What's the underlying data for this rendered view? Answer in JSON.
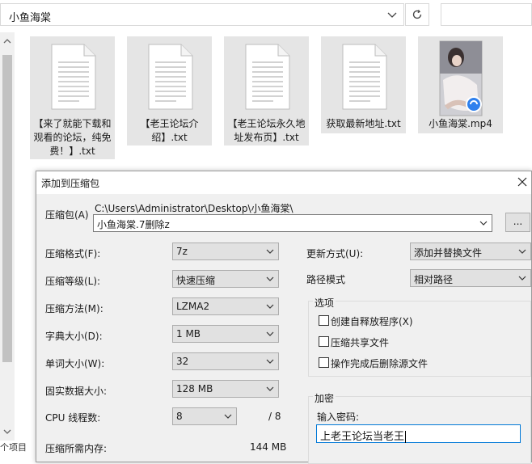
{
  "explorer": {
    "address": "小鱼海棠",
    "status_partial": "个项目",
    "files": [
      {
        "label": "【来了就能下载和观看的论坛，纯免费！】.txt",
        "kind": "txt"
      },
      {
        "label": "【老王论坛介绍】.txt",
        "kind": "txt"
      },
      {
        "label": "【老王论坛永久地址发布页】.txt",
        "kind": "txt"
      },
      {
        "label": "获取最新地址.txt",
        "kind": "txt"
      },
      {
        "label": "小鱼海棠.mp4",
        "kind": "mp4"
      }
    ]
  },
  "dialog": {
    "title": "添加到压缩包",
    "archive_label": "压缩包(A)",
    "archive_path": "C:\\Users\\Administrator\\Desktop\\小鱼海棠\\",
    "archive_name": "小鱼海棠.7删除z",
    "browse_label": "...",
    "format_label": "压缩格式(F):",
    "format_value": "7z",
    "level_label": "压缩等级(L):",
    "level_value": "快速压缩",
    "method_label": "压缩方法(M):",
    "method_value": "LZMA2",
    "dict_label": "字典大小(D):",
    "dict_value": "1 MB",
    "word_label": "单词大小(W):",
    "word_value": "32",
    "solid_label": "固实数据大小:",
    "solid_value": "128 MB",
    "cpu_label": "CPU 线程数:",
    "cpu_value": "8",
    "cpu_total": "/ 8",
    "memory_label": "压缩所需内存:",
    "memory_value": "144 MB",
    "update_label": "更新方式(U):",
    "update_value": "添加并替换文件",
    "path_mode_label": "路径模式",
    "path_mode_value": "相对路径",
    "options_title": "选项",
    "opt_sfx": "创建自释放程序(X)",
    "opt_shared": "压缩共享文件",
    "opt_delete": "操作完成后删除源文件",
    "encrypt_title": "加密",
    "password_label": "输入密码:",
    "password_value": "上老王论坛当老王"
  }
}
